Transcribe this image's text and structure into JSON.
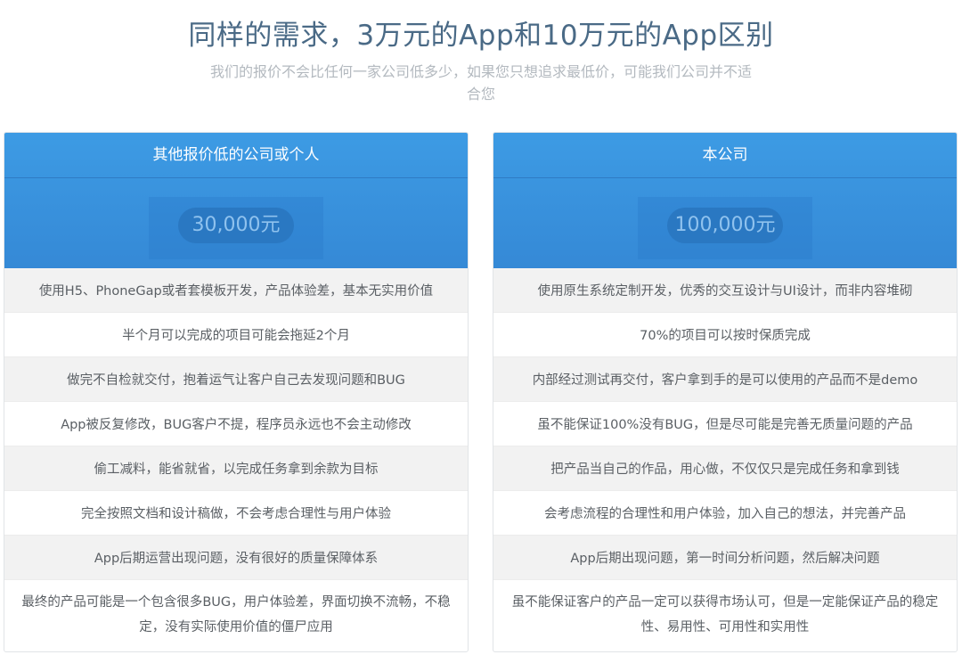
{
  "header": {
    "title": "同样的需求，3万元的App和10万元的App区别",
    "subtitle": "我们的报价不会比任何一家公司低多少，如果您只想追求最低价，可能我们公司并不适合您"
  },
  "left_card": {
    "title": "其他报价低的公司或个人",
    "price": "30,000元",
    "rows": [
      "使用H5、PhoneGap或者套模板开发，产品体验差，基本无实用价值",
      "半个月可以完成的项目可能会拖延2个月",
      "做完不自检就交付，抱着运气让客户自己去发现问题和BUG",
      "App被反复修改，BUG客户不提，程序员永远也不会主动修改",
      "偷工减料，能省就省，以完成任务拿到余款为目标",
      "完全按照文档和设计稿做，不会考虑合理性与用户体验",
      "App后期运营出现问题，没有很好的质量保障体系",
      "最终的产品可能是一个包含很多BUG，用户体验差，界面切换不流畅，不稳定，没有实际使用价值的僵尸应用"
    ]
  },
  "right_card": {
    "title": "本公司",
    "price": "100,000元",
    "rows": [
      "使用原生系统定制开发，优秀的交互设计与UI设计，而非内容堆砌",
      "70%的项目可以按时保质完成",
      "内部经过测试再交付，客户拿到手的是可以使用的产品而不是demo",
      "虽不能保证100%没有BUG，但是尽可能是完善无质量问题的产品",
      "把产品当自己的作品，用心做，不仅仅只是完成任务和拿到钱",
      "会考虑流程的合理性和用户体验，加入自己的想法，并完善产品",
      "App后期出现问题，第一时间分析问题，然后解决问题",
      "虽不能保证客户的产品一定可以获得市场认可，但是一定能保证产品的稳定性、易用性、可用性和实用性"
    ]
  }
}
